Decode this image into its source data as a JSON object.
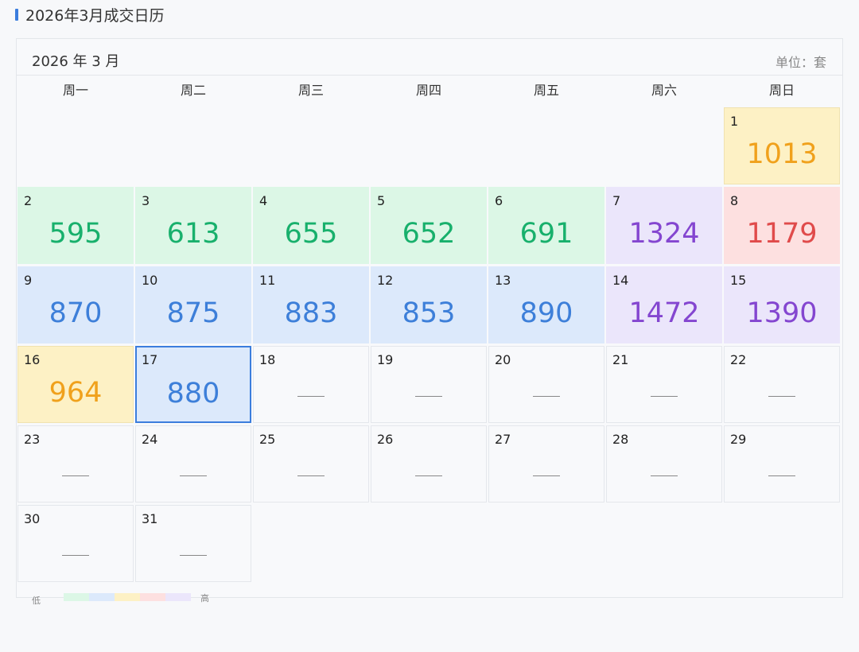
{
  "title": "2026年3月成交日历",
  "month_label": "2026 年 3 月",
  "unit_label": "单位：套",
  "weekdays": [
    "周一",
    "周二",
    "周三",
    "周四",
    "周五",
    "周六",
    "周日"
  ],
  "start_weekday_index": 6,
  "selected_day": 17,
  "empty_marker": "——",
  "level_colors": {
    "green": {
      "bg": "#dcf7e6",
      "text": "#18b06c"
    },
    "blue": {
      "bg": "#dce9fb",
      "text": "#3d7fd9"
    },
    "yellow": {
      "bg": "#fdf1c5",
      "text": "#f0a11c"
    },
    "red": {
      "bg": "#fde0e0",
      "text": "#e04b4b"
    },
    "purple": {
      "bg": "#ebe6fb",
      "text": "#8446d0"
    }
  },
  "days": [
    {
      "day": "1",
      "value": "1013",
      "level": "yellow"
    },
    {
      "day": "2",
      "value": "595",
      "level": "green"
    },
    {
      "day": "3",
      "value": "613",
      "level": "green"
    },
    {
      "day": "4",
      "value": "655",
      "level": "green"
    },
    {
      "day": "5",
      "value": "652",
      "level": "green"
    },
    {
      "day": "6",
      "value": "691",
      "level": "green"
    },
    {
      "day": "7",
      "value": "1324",
      "level": "purple"
    },
    {
      "day": "8",
      "value": "1179",
      "level": "red"
    },
    {
      "day": "9",
      "value": "870",
      "level": "blue"
    },
    {
      "day": "10",
      "value": "875",
      "level": "blue"
    },
    {
      "day": "11",
      "value": "883",
      "level": "blue"
    },
    {
      "day": "12",
      "value": "853",
      "level": "blue"
    },
    {
      "day": "13",
      "value": "890",
      "level": "blue"
    },
    {
      "day": "14",
      "value": "1472",
      "level": "purple"
    },
    {
      "day": "15",
      "value": "1390",
      "level": "purple"
    },
    {
      "day": "16",
      "value": "964",
      "level": "yellow"
    },
    {
      "day": "17",
      "value": "880",
      "level": "blue"
    },
    {
      "day": "18",
      "value": null,
      "level": "none"
    },
    {
      "day": "19",
      "value": null,
      "level": "none"
    },
    {
      "day": "20",
      "value": null,
      "level": "none"
    },
    {
      "day": "21",
      "value": null,
      "level": "none"
    },
    {
      "day": "22",
      "value": null,
      "level": "none"
    },
    {
      "day": "23",
      "value": null,
      "level": "none"
    },
    {
      "day": "24",
      "value": null,
      "level": "none"
    },
    {
      "day": "25",
      "value": null,
      "level": "none"
    },
    {
      "day": "26",
      "value": null,
      "level": "none"
    },
    {
      "day": "27",
      "value": null,
      "level": "none"
    },
    {
      "day": "28",
      "value": null,
      "level": "none"
    },
    {
      "day": "29",
      "value": null,
      "level": "none"
    },
    {
      "day": "30",
      "value": null,
      "level": "none"
    },
    {
      "day": "31",
      "value": null,
      "level": "none"
    }
  ],
  "legend": {
    "low_label": "低",
    "high_label": "高",
    "swatches": [
      "#dcf7e6",
      "#dce9fb",
      "#fdf1c5",
      "#fde0e0",
      "#ebe6fb"
    ]
  }
}
